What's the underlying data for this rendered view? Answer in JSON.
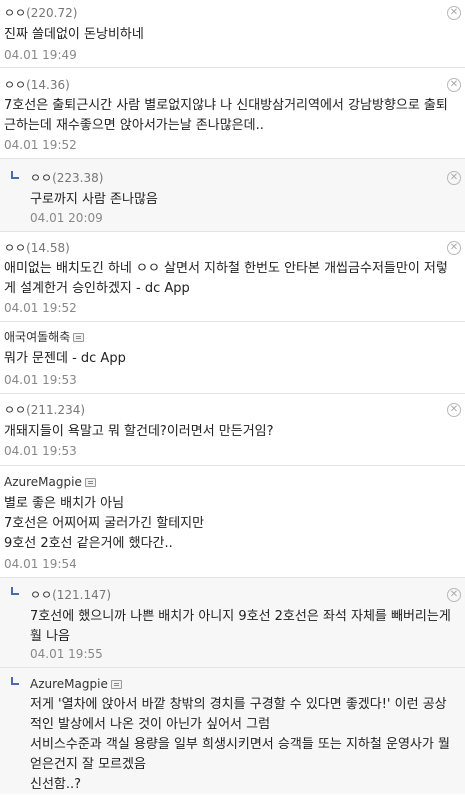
{
  "comments": [
    {
      "name": "ㅇㅇ",
      "ip": "(220.72)",
      "text": "진짜 쓸데없이 돈낭비하네",
      "date": "04.01 19:49"
    },
    {
      "name": "ㅇㅇ",
      "ip": "(14.36)",
      "text": "7호선은 출퇴근시간 사람 별로없지않냐 나 신대방삼거리역에서 강남방향으로 출퇴근하는데 재수좋으면 앉아서가는날 존나많은데..",
      "date": "04.01 19:52"
    },
    {
      "name": "ㅇㅇ",
      "ip": "(223.38)",
      "text": "구로까지 사람 존나많음",
      "date": "04.01 20:09"
    },
    {
      "name": "ㅇㅇ",
      "ip": "(14.58)",
      "text": "애미없는 배치도긴 하네 ㅇㅇ 살면서 지하철 한번도 안타본 개씹금수저들만이 저렇게 설계한거 승인하겠지 - dc App",
      "date": "04.01 19:52"
    },
    {
      "name": "애국여돌해축",
      "text": "뭐가 문젠데 - dc App",
      "date": "04.01 19:53"
    },
    {
      "name": "ㅇㅇ",
      "ip": "(211.234)",
      "text": "개돼지들이 욕말고 뭐 할건데?이러면서 만든거임?",
      "date": "04.01 19:53"
    },
    {
      "name": "AzureMagpie",
      "text": "별로 좋은 배치가 아님\n7호선은 어찌어찌 굴러가긴 할테지만\n9호선 2호선 같은거에 했다간..",
      "date": "04.01 19:54"
    },
    {
      "name": "ㅇㅇ",
      "ip": "(121.147)",
      "text": "7호선에 했으니까 나쁜 배치가 아니지 9호선 2호선은 좌석 자체를 빼버리는게 훨 나음",
      "date": "04.01 19:55"
    },
    {
      "name": "AzureMagpie",
      "text": "저게 '열차에 앉아서 바깥 창밖의 경치를 구경할 수 있다면 좋겠다!' 이런 공상적인 발상에서 나온 것이 아닌가 싶어서 그럼\n서비스수준과 객실 용량을 일부 희생시키면서 승객들 또는 지하철 운영사가 뭘 얻은건지 잘 모르겠음\n신선함..?"
    }
  ],
  "delete_symbol": "✕"
}
